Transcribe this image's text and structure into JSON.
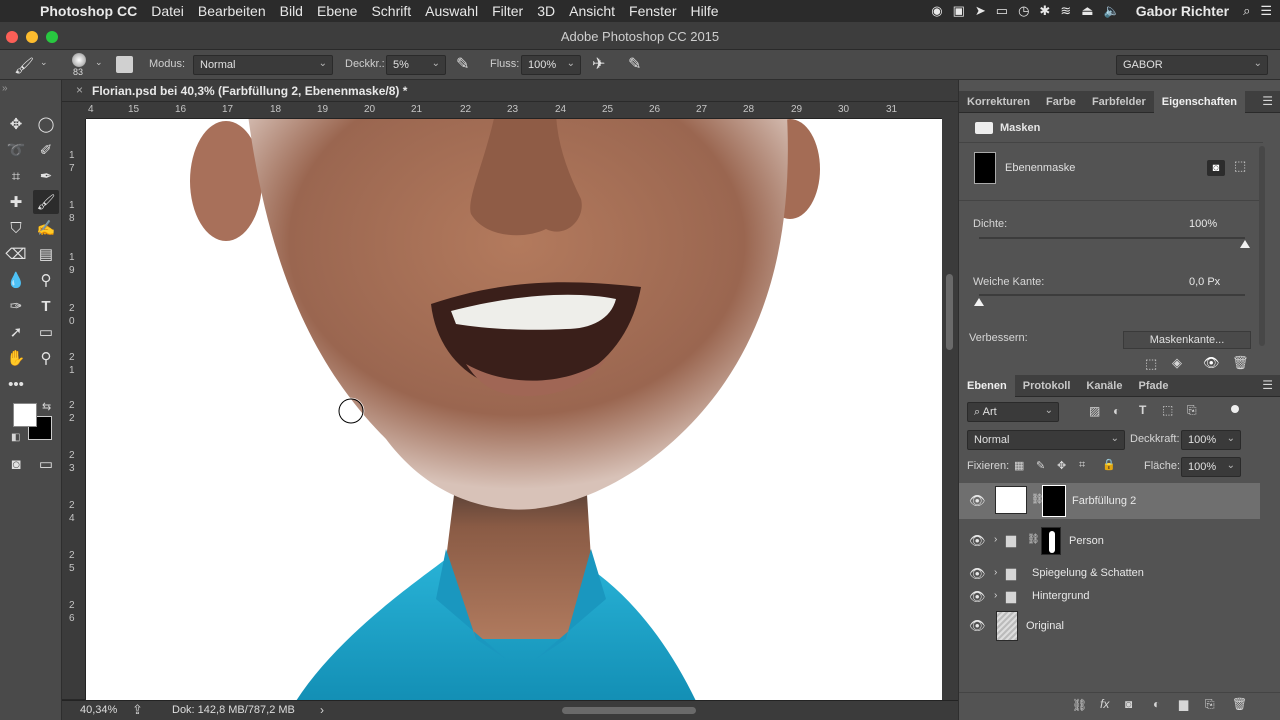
{
  "menubar": {
    "apple": "",
    "app_name": "Photoshop CC",
    "items": [
      "Datei",
      "Bearbeiten",
      "Bild",
      "Ebene",
      "Schrift",
      "Auswahl",
      "Filter",
      "3D",
      "Ansicht",
      "Fenster",
      "Hilfe"
    ],
    "user": "Gabor Richter"
  },
  "window": {
    "title": "Adobe Photoshop CC 2015"
  },
  "options": {
    "brush_size": "83",
    "mode_label": "Modus:",
    "mode_value": "Normal",
    "opacity_label": "Deckkr.:",
    "opacity_value": "5%",
    "flow_label": "Fluss:",
    "flow_value": "100%",
    "workspace": "GABOR"
  },
  "document": {
    "tab_title": "Florian.psd bei 40,3% (Farbfüllung 2, Ebenenmaske/8) *",
    "hruler_ticks": [
      "4",
      "15",
      "16",
      "17",
      "18",
      "19",
      "20",
      "21",
      "22",
      "23",
      "24",
      "25",
      "26",
      "27",
      "28",
      "29",
      "30",
      "31"
    ],
    "vruler_ticks": [
      "1 7",
      "1 8",
      "1 9",
      "2 0",
      "2 1",
      "2 2",
      "2 3",
      "2 4",
      "2 5",
      "2 6"
    ],
    "zoom": "40,34%",
    "doc_info": "Dok: 142,8 MB/787,2 MB"
  },
  "properties": {
    "tabs": [
      "Korrekturen",
      "Farbe",
      "Farbfelder",
      "Eigenschaften"
    ],
    "active_tab": "Eigenschaften",
    "header": "Masken",
    "mask_name": "Ebenenmaske",
    "density_label": "Dichte:",
    "density_value": "100%",
    "density_level": 1.0,
    "feather_label": "Weiche Kante:",
    "feather_value": "0,0 Px",
    "feather_level": 0.0,
    "refine_label": "Verbessern:",
    "refine_button": "Maskenkante..."
  },
  "layers": {
    "tabs": [
      "Ebenen",
      "Protokoll",
      "Kanäle",
      "Pfade"
    ],
    "active_tab": "Ebenen",
    "filter_kind": "Art",
    "blend_mode": "Normal",
    "opacity_label": "Deckkraft:",
    "opacity_value": "100%",
    "lock_label": "Fixieren:",
    "fill_label": "Fläche:",
    "fill_value": "100%",
    "items": [
      {
        "name": "Farbfüllung 2",
        "selected": true
      },
      {
        "name": "Person"
      },
      {
        "name": "Spiegelung & Schatten"
      },
      {
        "name": "Hintergrund"
      },
      {
        "name": "Original"
      }
    ]
  },
  "colors": {
    "accent_skin": "#c58a6a",
    "shirt": "#1aa3c9",
    "panel_bg": "#535353"
  }
}
